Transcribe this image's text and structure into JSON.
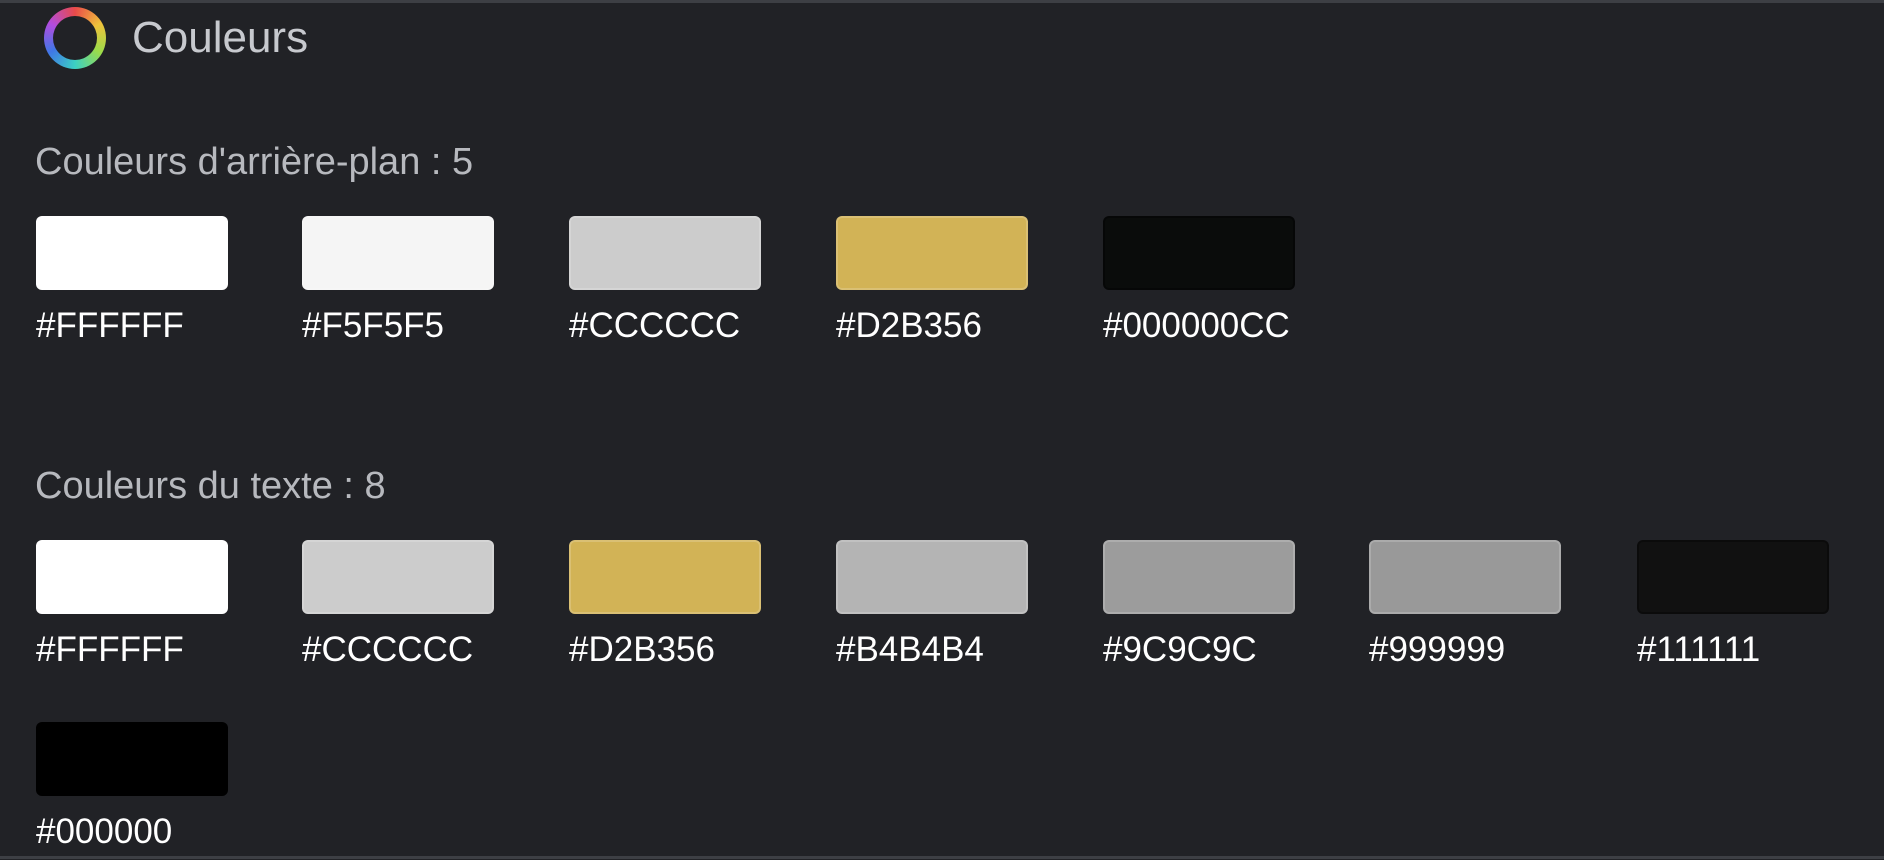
{
  "header": {
    "title": "Couleurs",
    "logo_icon": "color-wheel-icon"
  },
  "background_colors": {
    "heading": "Couleurs d'arrière-plan : 5",
    "items": [
      {
        "hex": "#FFFFFF",
        "color": "#FFFFFF"
      },
      {
        "hex": "#F5F5F5",
        "color": "#F5F5F5"
      },
      {
        "hex": "#CCCCCC",
        "color": "#CCCCCC"
      },
      {
        "hex": "#D2B356",
        "color": "#D2B356"
      },
      {
        "hex": "#000000CC",
        "color": "#0A0C0B"
      }
    ]
  },
  "text_colors": {
    "heading": "Couleurs du texte : 8",
    "items": [
      {
        "hex": "#FFFFFF",
        "color": "#FFFFFF"
      },
      {
        "hex": "#CCCCCC",
        "color": "#CCCCCC"
      },
      {
        "hex": "#D2B356",
        "color": "#D2B356"
      },
      {
        "hex": "#B4B4B4",
        "color": "#B4B4B4"
      },
      {
        "hex": "#9C9C9C",
        "color": "#9C9C9C"
      },
      {
        "hex": "#999999",
        "color": "#999999"
      },
      {
        "hex": "#111111",
        "color": "#111111"
      },
      {
        "hex": "#000000",
        "color": "#000000"
      }
    ]
  }
}
